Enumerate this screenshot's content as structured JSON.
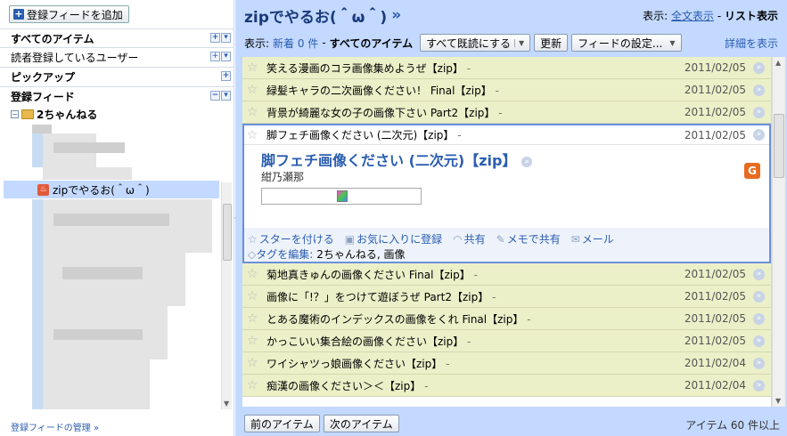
{
  "sidebar": {
    "add_feed_button": "登録フィードを追加",
    "nav": {
      "all_items": "すべてのアイテム",
      "subscribers": "読者登録しているユーザー",
      "picks": "ピックアップ",
      "feeds": "登録フィード"
    },
    "folder": "2ちゃんねる",
    "selected_feed": "zipでやるお(＾ω＾)",
    "manage_link": "登録フィードの管理 »"
  },
  "header": {
    "title": "zipでやるお(＾ω＾)",
    "title_arrow": "»",
    "view_label": "表示:",
    "view_full": "全文表示",
    "view_sep": "-",
    "view_list": "リスト表示"
  },
  "toolbar": {
    "show_label": "表示:",
    "new_items": "新着 0 件",
    "sep": "-",
    "all_items": "すべてのアイテム",
    "mark_all_read": "すべて既読にする",
    "refresh": "更新",
    "feed_settings": "フィードの設定...",
    "details": "詳細を表示"
  },
  "items_top": [
    {
      "title": "笑える漫画のコラ画像集めようぜ【zip】",
      "snippet": "-",
      "date": "2011/02/05"
    },
    {
      "title": "緑髪キャラの二次画像ください！ Final【zip】",
      "snippet": "-",
      "date": "2011/02/05"
    },
    {
      "title": "背景が綺麗な女の子の画像下さい Part2【zip】",
      "snippet": "-",
      "date": "2011/02/05"
    }
  ],
  "expanded": {
    "title": "脚フェチ画像ください (二次元)【zip】",
    "snippet": "-",
    "date": "2011/02/05",
    "author": "紺乃瀬那",
    "actions": {
      "star": "スターを付ける",
      "favorite": "お気に入りに登録",
      "share": "共有",
      "share_note": "メモで共有",
      "email": "メール"
    },
    "tags_label": "タグを編集:",
    "tags": "2ちゃんねる, 画像"
  },
  "items_bottom": [
    {
      "title": "菊地真きゅんの画像ください Final【zip】",
      "snippet": "-",
      "date": "2011/02/05"
    },
    {
      "title": "画像に「!？」をつけて遊ぼうぜ Part2【zip】",
      "snippet": "-",
      "date": "2011/02/05"
    },
    {
      "title": "とある魔術のインデックスの画像をくれ Final【zip】",
      "snippet": "-",
      "date": "2011/02/05"
    },
    {
      "title": "かっこいい集合絵の画像ください【zip】",
      "snippet": "-",
      "date": "2011/02/05"
    },
    {
      "title": "ワイシャツっ娘画像ください【zip】",
      "snippet": "-",
      "date": "2011/02/04"
    },
    {
      "title": "痴漢の画像ください＞＜【zip】",
      "snippet": "-",
      "date": "2011/02/04"
    }
  ],
  "footer": {
    "prev": "前のアイテム",
    "next": "次のアイテム",
    "count": "アイテム 60 件以上"
  },
  "colors": {
    "accent": "#c3d9ff",
    "link": "#2a5db0",
    "row_bg": "#ebf0c8"
  },
  "icons": [
    "plus-icon",
    "folder-icon",
    "star-icon",
    "go-arrow-icon",
    "feed-icon",
    "google-icon"
  ]
}
